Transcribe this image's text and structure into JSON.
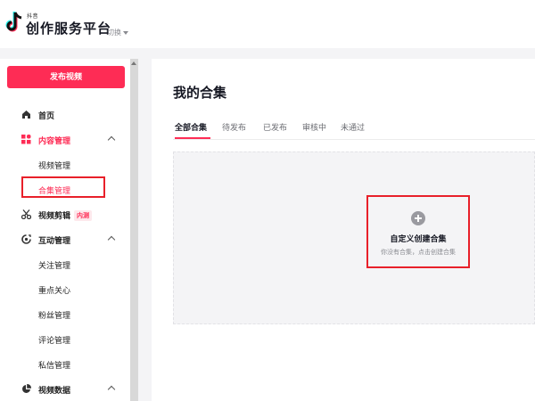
{
  "header": {
    "brand_small": "抖音",
    "brand_title": "创作服务平台",
    "switch_label": "切换"
  },
  "sidebar": {
    "publish_label": "发布视频",
    "items": [
      {
        "label": "首页",
        "icon": "home-icon"
      },
      {
        "label": "内容管理",
        "icon": "content-icon"
      },
      {
        "label": "视频管理"
      },
      {
        "label": "合集管理"
      },
      {
        "label": "视频剪辑",
        "icon": "scissors-icon",
        "badge": "内测"
      },
      {
        "label": "互动管理",
        "icon": "interaction-icon"
      },
      {
        "label": "关注管理"
      },
      {
        "label": "重点关心"
      },
      {
        "label": "粉丝管理"
      },
      {
        "label": "评论管理"
      },
      {
        "label": "私信管理"
      },
      {
        "label": "视频数据",
        "icon": "chart-icon"
      }
    ]
  },
  "main": {
    "title": "我的合集",
    "tabs": [
      {
        "label": "全部合集"
      },
      {
        "label": "待发布"
      },
      {
        "label": "已发布"
      },
      {
        "label": "审核中"
      },
      {
        "label": "未通过"
      }
    ],
    "create": {
      "title": "自定义创建合集",
      "subtitle": "你没有合集，点击创建合集"
    }
  },
  "colors": {
    "accent": "#fe2c55",
    "highlight_box": "#e8202a"
  }
}
